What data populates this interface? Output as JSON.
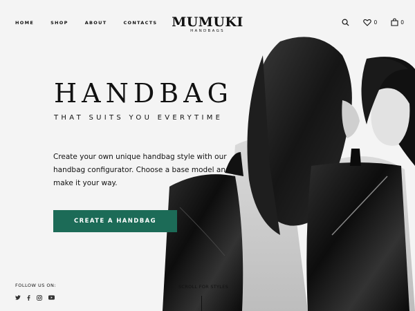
{
  "nav": {
    "items": [
      {
        "label": "HOME"
      },
      {
        "label": "SHOP"
      },
      {
        "label": "ABOUT"
      },
      {
        "label": "CONTACTS"
      }
    ]
  },
  "logo": {
    "brand": "MUMUKI",
    "sub": "HANDBAGS"
  },
  "tools": {
    "search_icon": "search-icon",
    "wishlist_count": "0",
    "cart_count": "0"
  },
  "hero": {
    "title": "HANDBAG",
    "subtitle": "THAT SUITS YOU EVERYTIME",
    "description": "Create your own unique handbag style with our handbag configurator. Choose a base model and make it your way.",
    "cta_label": "CREATE A HANDBAG"
  },
  "footer": {
    "follow_label": "FOLLOW US ON:",
    "social": [
      "twitter-icon",
      "facebook-icon",
      "instagram-icon",
      "youtube-icon"
    ],
    "scroll_label": "SCROLL FOR STYLES"
  },
  "colors": {
    "accent": "#1c6b57",
    "background": "#f4f4f4",
    "text": "#111111"
  }
}
